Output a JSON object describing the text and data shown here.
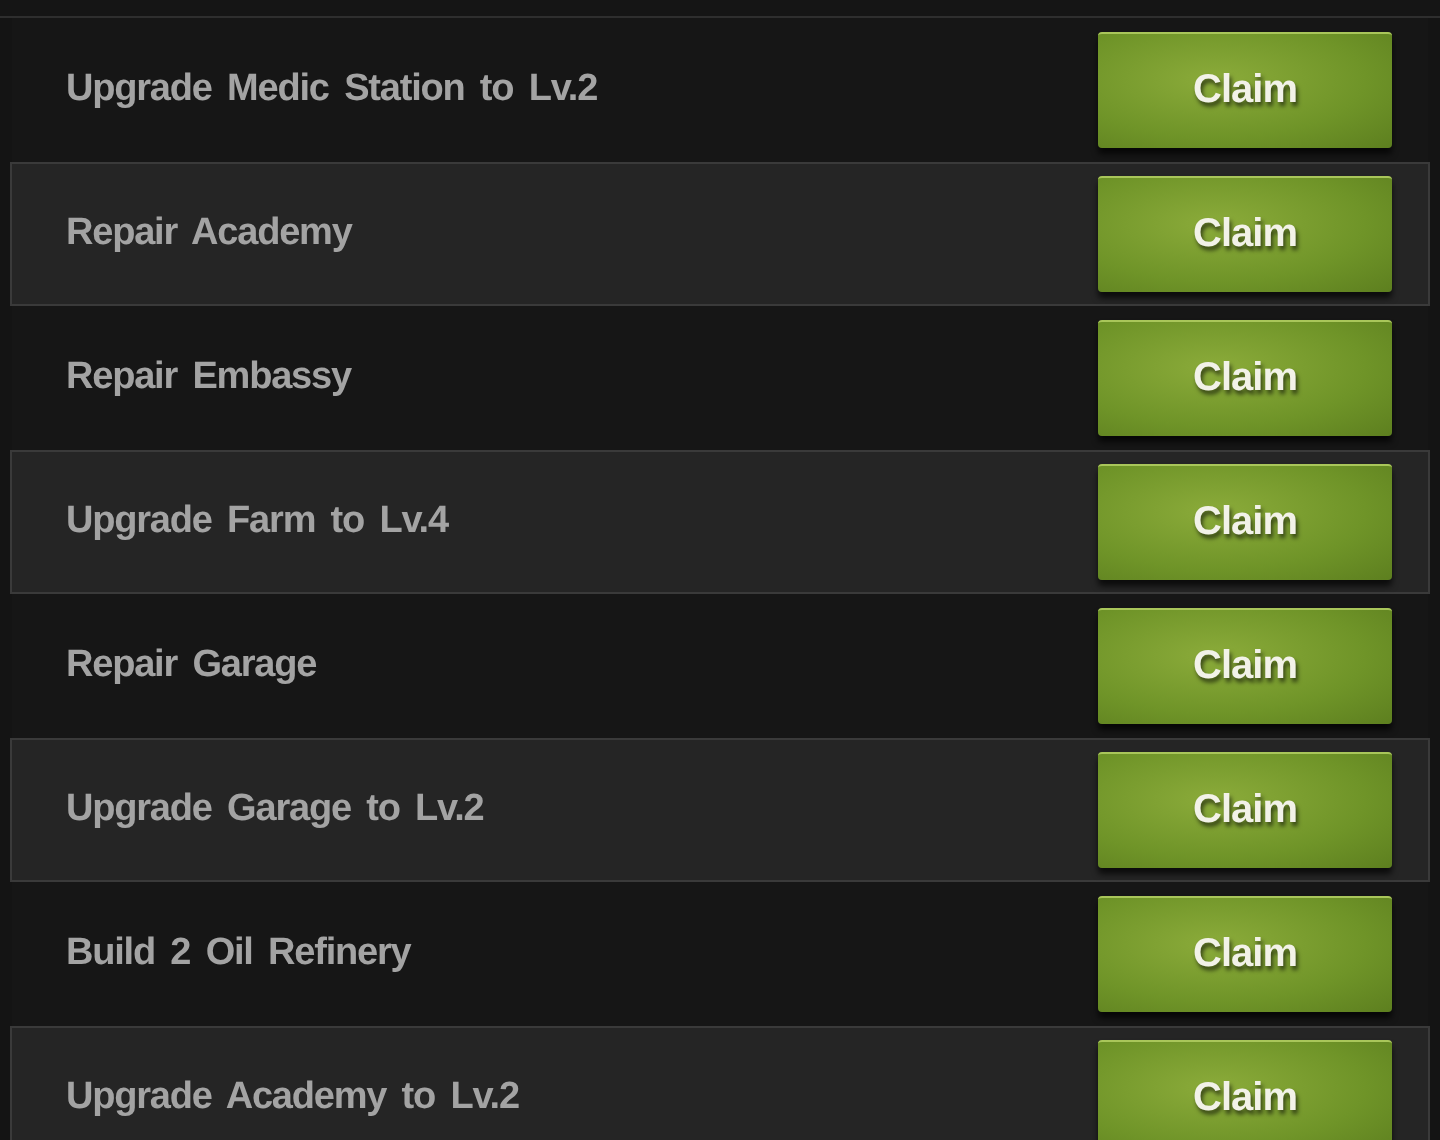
{
  "tasks": [
    {
      "label": "Upgrade Medic Station to Lv.2",
      "button": "Claim"
    },
    {
      "label": "Repair Academy",
      "button": "Claim"
    },
    {
      "label": "Repair Embassy",
      "button": "Claim"
    },
    {
      "label": "Upgrade Farm to Lv.4",
      "button": "Claim"
    },
    {
      "label": "Repair Garage",
      "button": "Claim"
    },
    {
      "label": "Upgrade Garage to Lv.2",
      "button": "Claim"
    },
    {
      "label": "Build 2 Oil Refinery",
      "button": "Claim"
    },
    {
      "label": "Upgrade Academy to Lv.2",
      "button": "Claim"
    }
  ]
}
